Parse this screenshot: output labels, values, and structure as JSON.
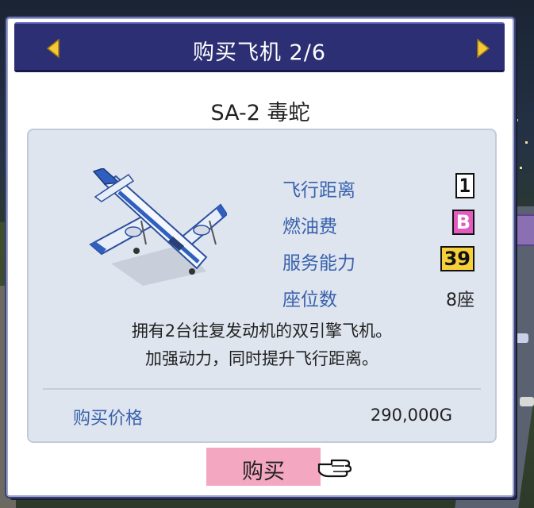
{
  "dialog": {
    "title": "购买飞机 2/6",
    "prev_icon": "arrow-left-icon",
    "next_icon": "arrow-right-icon",
    "plane_name": "SA-2 毒蛇",
    "stats": [
      {
        "label": "飞行距离",
        "value": "1"
      },
      {
        "label": "燃油费",
        "value": "B"
      },
      {
        "label": "服务能力",
        "value": "39"
      },
      {
        "label": "座位数",
        "value": "8座"
      }
    ],
    "description_line1": "拥有2台往复发动机的双引擎飞机。",
    "description_line2": "加强动力，同时提升飞行距离。",
    "price_label": "购买价格",
    "price_value": "290,000G",
    "buy_label": "购买",
    "pointer_icon": "hand-pointer-icon"
  },
  "colors": {
    "title_bar": "#2c2f74",
    "arrow": "#f5c936",
    "stat_label": "#3962ad",
    "panel": "#dfe5ef",
    "buy_button": "#f4a7c1",
    "fuel_badge": "#e25bc0",
    "service_badge": "#f6cf3a"
  }
}
